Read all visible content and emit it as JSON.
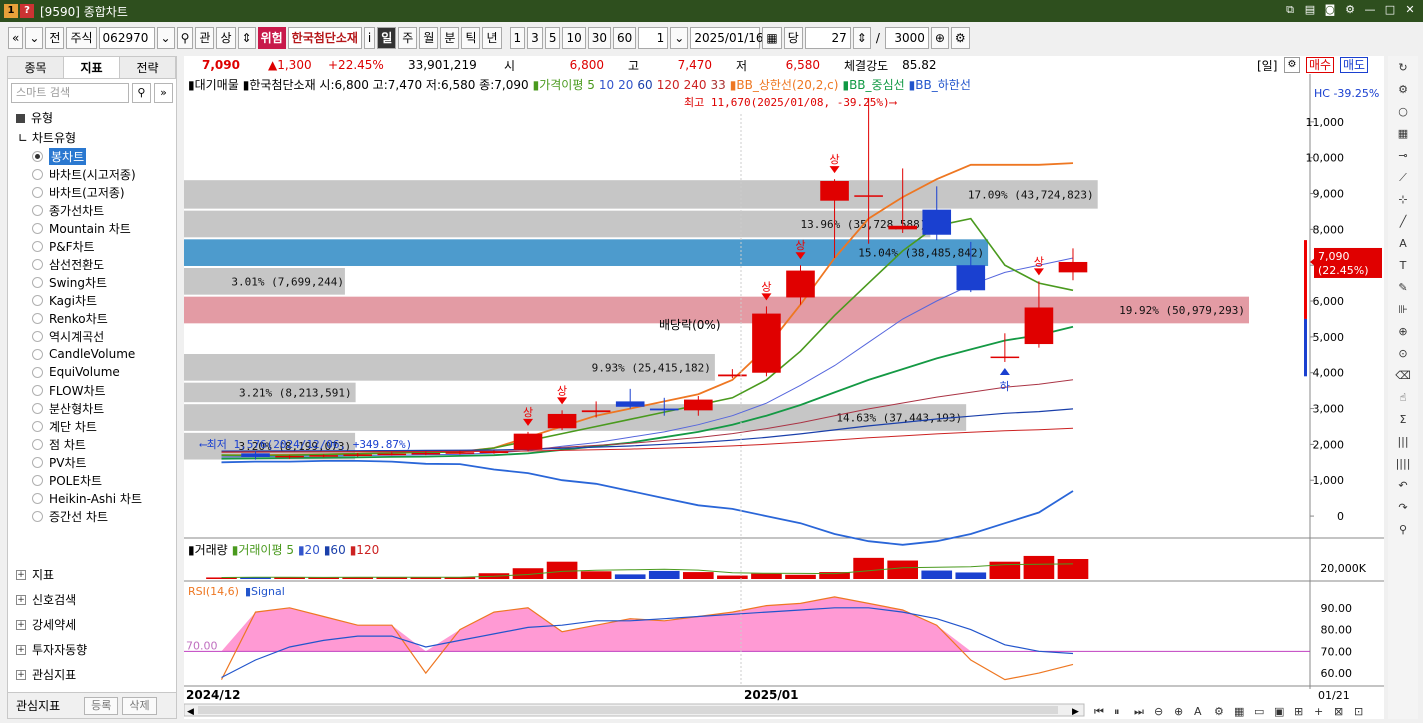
{
  "window": {
    "title": "[9590] 종합차트"
  },
  "toolbar": {
    "prev": "«",
    "dropdown": "⌄",
    "all": "전",
    "market": "주식",
    "code": "062970",
    "search": "⚲",
    "gwan": "관",
    "sang": "상",
    "warning": "위험",
    "stock_name": "한국첨단소재",
    "info": "i",
    "periods": [
      "일",
      "주",
      "월",
      "분",
      "틱",
      "년"
    ],
    "active_period": "일",
    "ticks": [
      "1",
      "3",
      "5",
      "10",
      "30",
      "60"
    ],
    "count_val": "1",
    "date": "2025/01/16",
    "dang": "당",
    "bars": "27",
    "slash": "/",
    "total": "3000"
  },
  "left": {
    "tabs": [
      "종목",
      "지표",
      "전략"
    ],
    "active_tab": "지표",
    "search_placeholder": "스마트 검색",
    "section": "유형",
    "chart_type_title": "차트유형",
    "chart_types": [
      "봉차트",
      "바차트(시고저종)",
      "바차트(고저종)",
      "종가선차트",
      "Mountain 차트",
      "P&F차트",
      "삼선전환도",
      "Swing차트",
      "Kagi차트",
      "Renko차트",
      "역시계곡선",
      "CandleVolume",
      "EquiVolume",
      "FLOW차트",
      "분산형차트",
      "계단 차트",
      "점 차트",
      "PV차트",
      "POLE차트",
      "Heikin-Ashi 차트",
      "증간선 차트"
    ],
    "selected": "봉차트",
    "trees": [
      "지표",
      "신호검색",
      "강세약세",
      "투자자동향",
      "관심지표"
    ],
    "fav_label": "관심지표",
    "fav_add": "등록",
    "fav_del": "삭제"
  },
  "info": {
    "price": "7,090",
    "change": "▲1,300",
    "pct": "+22.45%",
    "volume": "33,901,219",
    "open_lbl": "시",
    "open": "6,800",
    "high_lbl": "고",
    "high": "7,470",
    "low_lbl": "저",
    "low": "6,580",
    "strength_lbl": "체결강도",
    "strength": "85.82",
    "period_tag": "[일]",
    "buy": "매수",
    "sell": "매도"
  },
  "chart_data": {
    "type": "candlestick",
    "legend_main": [
      "▮대기매물",
      "▮한국첨단소재 시:6,800 고:7,470 저:6,580 종:7,090",
      "▮가격이평 5",
      "10",
      "20",
      "60",
      "120",
      "240",
      "33",
      "▮BB_상한선(20,2,c)",
      "▮BB_중심선",
      "▮BB_하한선"
    ],
    "legend_colors": [
      "#000",
      "#000",
      "#4a9a1e",
      "#3355cc",
      "#3355cc",
      "#1a3faa",
      "#cc2222",
      "#cc2222",
      "#aa3333",
      "#ee7722",
      "#119944",
      "#2255cc"
    ],
    "y_ticks": [
      11000,
      10000,
      9000,
      8000,
      7000,
      6000,
      5000,
      4000,
      3000,
      2000,
      1000,
      0
    ],
    "ylim": [
      -500,
      12000
    ],
    "x_labels": [
      "2024/12",
      "2025/01"
    ],
    "last_date_label": "01/21",
    "right_top_label": "HC -39.25%",
    "current_price_label": "7,090",
    "current_pct_label": "(22.45%)",
    "max_annotation": "최고 11,670(2025/01/08, -39.25%)⟶",
    "min_annotation": "⟵최저 1,576(2024/12/06, +349.87%)",
    "dividend_annotation": "배당락(0%)",
    "up_marker": "상",
    "down_marker": "하",
    "volume_profile": [
      {
        "lo": 8550,
        "hi": 9400,
        "label": "17.09% (43,724,823)",
        "pct": 17.09,
        "color": "#c0c0c0"
      },
      {
        "lo": 7750,
        "hi": 8550,
        "label": "13.96% (35,728,588)",
        "pct": 13.96,
        "color": "#c0c0c0"
      },
      {
        "lo": 6950,
        "hi": 7750,
        "label": "15.04% (38,485,842)",
        "pct": 15.04,
        "color": "#3a90c8"
      },
      {
        "lo": 6150,
        "hi": 6950,
        "label": "3.01% (7,699,244)",
        "pct": 3.01,
        "color": "#c0c0c0"
      },
      {
        "lo": 5350,
        "hi": 6150,
        "label": "19.92% (50,979,293)",
        "pct": 19.92,
        "color": "#e0909a"
      },
      {
        "lo": 4550,
        "hi": 5350,
        "label": "",
        "pct": 0,
        "color": "#c0c0c0"
      },
      {
        "lo": 3750,
        "hi": 4550,
        "label": "9.93% (25,415,182)",
        "pct": 9.93,
        "color": "#c0c0c0"
      },
      {
        "lo": 3150,
        "hi": 3750,
        "label": "3.21% (8,213,591)",
        "pct": 3.21,
        "color": "#c0c0c0"
      },
      {
        "lo": 2350,
        "hi": 3150,
        "label": "14.63% (37,443,193)",
        "pct": 14.63,
        "color": "#c0c0c0"
      },
      {
        "lo": 1550,
        "hi": 2350,
        "label": "3.20% (8,199,073)",
        "pct": 3.2,
        "color": "#c0c0c0"
      }
    ],
    "candles": [
      {
        "o": 1750,
        "h": 1800,
        "l": 1576,
        "c": 1650
      },
      {
        "o": 1650,
        "h": 1700,
        "l": 1600,
        "c": 1680
      },
      {
        "o": 1680,
        "h": 1720,
        "l": 1640,
        "c": 1700
      },
      {
        "o": 1700,
        "h": 1760,
        "l": 1660,
        "c": 1720
      },
      {
        "o": 1720,
        "h": 1780,
        "l": 1690,
        "c": 1740
      },
      {
        "o": 1740,
        "h": 1800,
        "l": 1700,
        "c": 1760
      },
      {
        "o": 1760,
        "h": 1820,
        "l": 1720,
        "c": 1780
      },
      {
        "o": 1780,
        "h": 1830,
        "l": 1740,
        "c": 1800
      },
      {
        "o": 1850,
        "h": 2350,
        "l": 1800,
        "c": 2300
      },
      {
        "o": 2450,
        "h": 2950,
        "l": 2400,
        "c": 2850
      },
      {
        "o": 2900,
        "h": 3200,
        "l": 2750,
        "c": 2950
      },
      {
        "o": 3200,
        "h": 3550,
        "l": 3000,
        "c": 3050
      },
      {
        "o": 3000,
        "h": 3300,
        "l": 2800,
        "c": 2950
      },
      {
        "o": 2950,
        "h": 3350,
        "l": 2800,
        "c": 3250
      },
      {
        "o": 3900,
        "h": 4100,
        "l": 3850,
        "c": 3950
      },
      {
        "o": 4000,
        "h": 5850,
        "l": 3900,
        "c": 5650
      },
      {
        "o": 6100,
        "h": 7000,
        "l": 5900,
        "c": 6850
      },
      {
        "o": 8800,
        "h": 9400,
        "l": 7200,
        "c": 9350
      },
      {
        "o": 8950,
        "h": 11670,
        "l": 7600,
        "c": 8950
      },
      {
        "o": 8000,
        "h": 9700,
        "l": 7900,
        "c": 8100
      },
      {
        "o": 8550,
        "h": 9200,
        "l": 7700,
        "c": 7850
      },
      {
        "o": 7000,
        "h": 7650,
        "l": 6250,
        "c": 6300
      },
      {
        "o": 4450,
        "h": 5100,
        "l": 4300,
        "c": 4450
      },
      {
        "o": 4800,
        "h": 6550,
        "l": 4700,
        "c": 5820
      },
      {
        "o": 6800,
        "h": 7470,
        "l": 6580,
        "c": 7090
      }
    ],
    "ma5": [
      1700,
      1690,
      1700,
      1720,
      1740,
      1760,
      1780,
      1790,
      1900,
      2100,
      2300,
      2500,
      2700,
      2900,
      3100,
      3300,
      3800,
      4600,
      5600,
      6500,
      7400,
      8100,
      8300,
      7000,
      6500,
      6300
    ],
    "bb_upper": [
      1700,
      1700,
      1710,
      1720,
      1740,
      1760,
      1780,
      1800,
      1900,
      2200,
      2500,
      2800,
      3000,
      3200,
      3400,
      3800,
      4700,
      5900,
      7200,
      8300,
      8900,
      9400,
      9800,
      9800,
      9800,
      9850
    ],
    "bb_mid": [
      1600,
      1610,
      1620,
      1630,
      1640,
      1650,
      1660,
      1680,
      1700,
      1750,
      1850,
      1950,
      2050,
      2200,
      2350,
      2550,
      2800,
      3100,
      3450,
      3800,
      4100,
      4400,
      4650,
      4900,
      5050,
      5280
    ],
    "bb_lower": [
      1500,
      1520,
      1520,
      1540,
      1540,
      1520,
      1460,
      1450,
      1300,
      1200,
      1000,
      900,
      700,
      500,
      300,
      200,
      0,
      -200,
      -500,
      -700,
      -800,
      -700,
      -500,
      -200,
      100,
      700
    ],
    "ma20": [
      1650,
      1660,
      1670,
      1680,
      1690,
      1700,
      1710,
      1720,
      1760,
      1830,
      1950,
      2050,
      2200,
      2350,
      2550,
      2800,
      3150,
      3650,
      4200,
      4850,
      5500,
      6000,
      6450,
      6800,
      7000,
      7200
    ],
    "volume_legend": [
      "▮거래량",
      "▮거래이평 5",
      "▮20",
      "▮60",
      "▮120"
    ],
    "volume_tick": "20,000K",
    "volumes": [
      400,
      500,
      420,
      380,
      450,
      480,
      520,
      500,
      1500,
      2800,
      4500,
      2000,
      1200,
      2100,
      1800,
      900,
      1400,
      1100,
      1800,
      5500,
      4800,
      2200,
      1700,
      4500,
      6000,
      5200
    ],
    "rsi_legend": [
      "RSI(14,6)",
      "▮Signal"
    ],
    "rsi_ticks": [
      90,
      80,
      70,
      60
    ],
    "rsi_ylim": [
      55,
      100
    ],
    "rsi_ref": 70,
    "rsi": [
      57,
      88,
      90,
      86,
      82,
      82,
      60,
      80,
      88,
      90,
      79,
      82,
      85,
      84,
      86,
      88,
      91,
      92,
      95,
      92,
      89,
      82,
      66,
      57,
      60,
      64
    ],
    "signal": [
      58,
      66,
      72,
      75,
      77,
      77,
      72,
      75,
      78,
      81,
      82,
      84,
      84,
      85,
      86,
      87,
      88,
      89,
      90,
      90,
      88,
      85,
      80,
      73,
      70,
      69
    ]
  },
  "colors": {
    "up": "#e00000",
    "down": "#1a40d0",
    "title_bg": "#2e4f1e"
  },
  "right_tools": [
    "refresh-icon",
    "settings-icon",
    "circle-icon",
    "chart-icon",
    "line-icon",
    "trend-icon",
    "ray-icon",
    "diag-icon",
    "auto-icon",
    "text-icon",
    "pencil-icon",
    "candle-icon",
    "magnifier-icon",
    "zoom-icon",
    "erase-icon",
    "hand-icon",
    "fib-icon",
    "vlines-icon",
    "vlines2-icon",
    "undo-icon",
    "redo-icon",
    "search-icon"
  ],
  "right_tool_glyphs": [
    "↻",
    "⚙",
    "○",
    "▦",
    "⊸",
    "⟋",
    "⊹",
    "╱",
    "A",
    "T",
    "✎",
    "⊪",
    "⊕",
    "⊙",
    "⌫",
    "☝",
    "Σ",
    "|||",
    "||||",
    "↶",
    "↷",
    "⚲"
  ]
}
